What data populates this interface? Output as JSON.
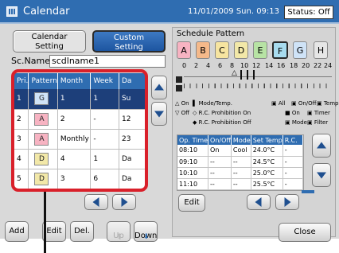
{
  "title_bar": {
    "app_title": "Calendar",
    "datetime": "11/01/2009 Sun. 09:13",
    "status": "Status: Off"
  },
  "tabs": [
    {
      "line1": "Calendar",
      "line2": "Setting"
    },
    {
      "line1": "Custom",
      "line2": "Setting"
    }
  ],
  "schedule_name": {
    "label": "Sc.Name",
    "value": "scdlname1"
  },
  "priority_table": {
    "headers": [
      "Pri.",
      "Pattern",
      "Month",
      "Week",
      "Da"
    ],
    "rows": [
      {
        "pri": "1",
        "pattern": "G",
        "month": "1",
        "week": "1",
        "day": "Su",
        "selected": true
      },
      {
        "pri": "2",
        "pattern": "A",
        "month": "2",
        "week": "-",
        "day": "12"
      },
      {
        "pri": "3",
        "pattern": "A",
        "month": "Monthly",
        "week": "-",
        "day": "23"
      },
      {
        "pri": "4",
        "pattern": "D",
        "month": "4",
        "week": "1",
        "day": "Da"
      },
      {
        "pri": "5",
        "pattern": "D",
        "month": "3",
        "week": "6",
        "day": "Da"
      }
    ]
  },
  "bottom_buttons": {
    "add": "Add",
    "edit": "Edit",
    "delete": "Del.",
    "up": "Up",
    "down": "Down"
  },
  "schedule_pattern": {
    "title": "Schedule Pattern",
    "patterns": [
      {
        "label": "A",
        "color": "#f7b3c2"
      },
      {
        "label": "B",
        "color": "#f5b98a"
      },
      {
        "label": "C",
        "color": "#f6e4a0"
      },
      {
        "label": "D",
        "color": "#f2e8a8"
      },
      {
        "label": "E",
        "color": "#b7e3a4"
      },
      {
        "label": "F",
        "color": "#a8dcef"
      },
      {
        "label": "G",
        "color": "#cfe3f7"
      },
      {
        "label": "H",
        "color": "#e6e6e6"
      }
    ],
    "selected": "F",
    "hours": [
      "0",
      "2",
      "4",
      "6",
      "8",
      "10",
      "12",
      "14",
      "16",
      "18",
      "20",
      "22",
      "24"
    ],
    "legend": {
      "on": "On",
      "off": "Off",
      "mode_temp": "Mode/Temp.",
      "rc_prohib_on": "R.C. Prohibition On",
      "rc_prohib_off": "R.C. Prohibition Off",
      "all": "All",
      "on_off": "On/Off",
      "temp": "Temp",
      "on2": "On",
      "timer": "Timer",
      "mode": "Mode",
      "filter": "Filter"
    }
  },
  "op_table": {
    "headers": [
      "Op. Time",
      "On/Off",
      "Mode",
      "Set Temp",
      "R.C."
    ],
    "rows": [
      [
        "08:10",
        "On",
        "Cool",
        "24.0°C",
        "-"
      ],
      [
        "09:10",
        "--",
        "--",
        "24.5°C",
        "-"
      ],
      [
        "10:10",
        "--",
        "--",
        "25.0°C",
        "-"
      ],
      [
        "11:10",
        "--",
        "--",
        "25.5°C",
        "-"
      ]
    ]
  },
  "right_buttons": {
    "edit": "Edit",
    "close": "Close"
  }
}
